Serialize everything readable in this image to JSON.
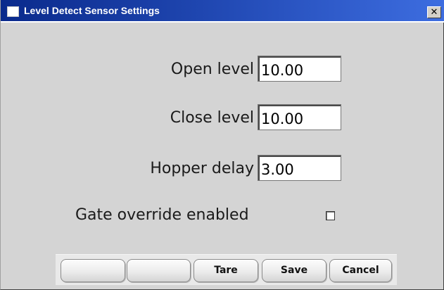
{
  "window": {
    "title": "Level Detect Sensor Settings",
    "icon": "window-app-icon",
    "close_glyph": "✕"
  },
  "fields": [
    {
      "label": "Open level",
      "value": "10.00"
    },
    {
      "label": "Close level",
      "value": "10.00"
    },
    {
      "label": "Hopper delay",
      "value": "3.00"
    }
  ],
  "gate_override": {
    "label": "Gate override enabled",
    "checked": false
  },
  "buttons": {
    "blank_1": "",
    "blank_2": "",
    "tare": "Tare",
    "save": "Save",
    "cancel": "Cancel"
  },
  "colors": {
    "titlebar_start": "#0a2a8c",
    "titlebar_end": "#3d6de0",
    "dialog_background": "#d4d4d4"
  }
}
